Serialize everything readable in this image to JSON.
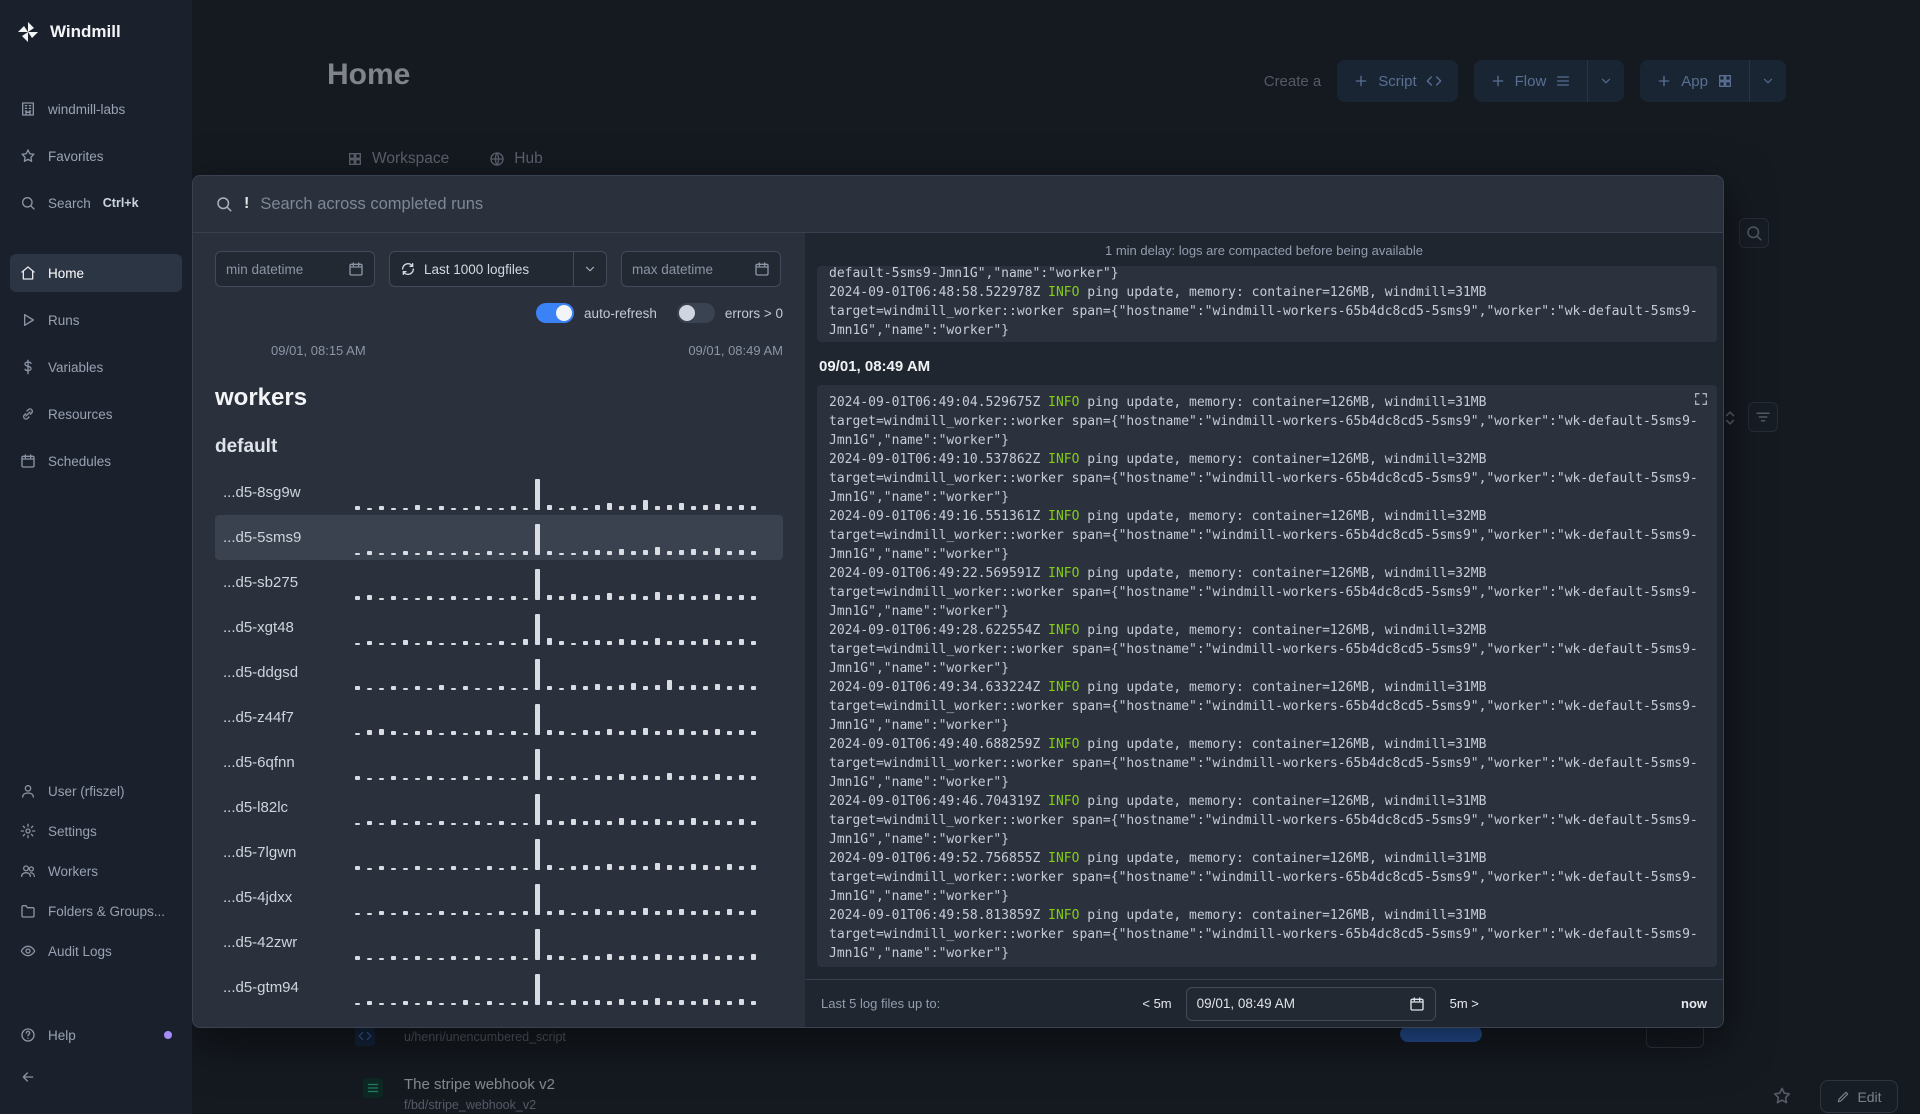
{
  "colors": {
    "accent": "#3b82f6",
    "info_level": "#84cc16",
    "spark_bar": "#d9dde3",
    "badge": "#3b82f6"
  },
  "sidebar": {
    "brand": "Windmill",
    "items": [
      {
        "id": "workspace",
        "label": "windmill-labs",
        "icon": "building"
      },
      {
        "id": "favorites",
        "label": "Favorites",
        "icon": "star"
      },
      {
        "id": "search",
        "label": "Search",
        "shortcut": "Ctrl+k",
        "icon": "search"
      },
      {
        "id": "home",
        "label": "Home",
        "icon": "home",
        "active": true,
        "gap_before": true
      },
      {
        "id": "runs",
        "label": "Runs",
        "icon": "play"
      },
      {
        "id": "variables",
        "label": "Variables",
        "icon": "dollar"
      },
      {
        "id": "resources",
        "label": "Resources",
        "icon": "link"
      },
      {
        "id": "schedules",
        "label": "Schedules",
        "icon": "calendar"
      }
    ],
    "bottom_items": [
      {
        "id": "user",
        "label": "User (rfiszel)",
        "icon": "user"
      },
      {
        "id": "settings",
        "label": "Settings",
        "icon": "gear"
      },
      {
        "id": "workers",
        "label": "Workers",
        "icon": "workers"
      },
      {
        "id": "folders",
        "label": "Folders & Groups...",
        "icon": "folder"
      },
      {
        "id": "audit-logs",
        "label": "Audit Logs",
        "icon": "eye"
      },
      {
        "id": "help",
        "label": "Help",
        "icon": "help",
        "dot": true
      }
    ]
  },
  "header": {
    "title": "Home",
    "create_label": "Create a",
    "buttons": [
      {
        "id": "script",
        "label": "Script",
        "trail_icon": "code",
        "has_dropdown": false
      },
      {
        "id": "flow",
        "label": "Flow",
        "trail_icon": "menu",
        "has_dropdown": true
      },
      {
        "id": "app",
        "label": "App",
        "trail_icon": "grid",
        "has_dropdown": true
      }
    ]
  },
  "tabs": [
    {
      "label": "Workspace",
      "icon": "grid"
    },
    {
      "label": "Hub",
      "icon": "globe"
    }
  ],
  "modal": {
    "search_prefix": "!",
    "search_placeholder": "Search across completed runs",
    "filters": {
      "min_datetime_placeholder": "min datetime",
      "logfiles_select_value": "Last 1000 logfiles",
      "max_datetime_placeholder": "max datetime",
      "auto_refresh_label": "auto-refresh",
      "errors_label": "errors > 0"
    },
    "range_start": "09/01, 08:15 AM",
    "range_end": "09/01, 08:49 AM",
    "workers_heading": "workers",
    "group_heading": "default",
    "workers": [
      {
        "name": "...d5-8sg9w",
        "spark": [
          3,
          2,
          3,
          2,
          2,
          4,
          2,
          3,
          2,
          2,
          3,
          2,
          2,
          3,
          2,
          26,
          4,
          2,
          3,
          2,
          4,
          6,
          3,
          4,
          8,
          3,
          4,
          6,
          3,
          4,
          5,
          3,
          4,
          3
        ]
      },
      {
        "name": "...d5-5sms9",
        "selected": true,
        "spark": [
          2,
          3,
          2,
          2,
          3,
          2,
          3,
          2,
          2,
          3,
          2,
          3,
          2,
          2,
          3,
          26,
          3,
          2,
          2,
          3,
          4,
          3,
          5,
          3,
          4,
          7,
          3,
          4,
          5,
          3,
          6,
          3,
          4,
          3
        ]
      },
      {
        "name": "...d5-sb275",
        "spark": [
          3,
          4,
          2,
          3,
          2,
          2,
          3,
          2,
          3,
          2,
          2,
          3,
          2,
          3,
          2,
          26,
          4,
          3,
          5,
          3,
          4,
          6,
          3,
          5,
          3,
          7,
          4,
          5,
          3,
          4,
          5,
          3,
          4,
          3
        ]
      },
      {
        "name": "...d5-xgt48",
        "spark": [
          2,
          3,
          2,
          2,
          4,
          2,
          3,
          2,
          2,
          3,
          2,
          2,
          3,
          2,
          5,
          26,
          6,
          3,
          2,
          3,
          4,
          3,
          5,
          4,
          3,
          6,
          3,
          4,
          3,
          5,
          4,
          3,
          5,
          3
        ]
      },
      {
        "name": "...d5-ddgsd",
        "spark": [
          3,
          2,
          2,
          3,
          2,
          3,
          2,
          4,
          2,
          3,
          2,
          2,
          3,
          2,
          2,
          26,
          3,
          2,
          4,
          3,
          5,
          3,
          4,
          6,
          3,
          4,
          8,
          3,
          4,
          3,
          5,
          3,
          4,
          3
        ]
      },
      {
        "name": "...d5-z44f7",
        "spark": [
          2,
          4,
          5,
          3,
          2,
          3,
          4,
          2,
          3,
          2,
          3,
          4,
          2,
          3,
          2,
          26,
          4,
          3,
          2,
          4,
          3,
          5,
          3,
          4,
          6,
          3,
          4,
          5,
          3,
          4,
          5,
          3,
          4,
          3
        ]
      },
      {
        "name": "...d5-6qfnn",
        "spark": [
          3,
          2,
          2,
          3,
          2,
          2,
          3,
          2,
          2,
          3,
          2,
          3,
          2,
          2,
          3,
          26,
          3,
          2,
          3,
          2,
          4,
          3,
          5,
          3,
          4,
          3,
          6,
          3,
          4,
          3,
          5,
          3,
          4,
          3
        ]
      },
      {
        "name": "...d5-l82lc",
        "spark": [
          2,
          3,
          2,
          4,
          2,
          3,
          2,
          3,
          2,
          2,
          3,
          2,
          3,
          2,
          2,
          26,
          4,
          3,
          5,
          3,
          4,
          3,
          6,
          4,
          3,
          5,
          3,
          4,
          6,
          3,
          4,
          3,
          5,
          3
        ]
      },
      {
        "name": "...d5-7lgwn",
        "spark": [
          3,
          2,
          3,
          2,
          2,
          3,
          2,
          2,
          3,
          2,
          2,
          3,
          2,
          3,
          2,
          26,
          4,
          2,
          3,
          4,
          3,
          5,
          3,
          4,
          3,
          6,
          4,
          3,
          5,
          4,
          3,
          5,
          3,
          4
        ]
      },
      {
        "name": "...d5-4jdxx",
        "spark": [
          2,
          2,
          3,
          2,
          3,
          2,
          2,
          3,
          2,
          3,
          2,
          2,
          3,
          2,
          3,
          26,
          3,
          4,
          2,
          3,
          5,
          3,
          4,
          3,
          6,
          3,
          4,
          5,
          3,
          4,
          3,
          5,
          3,
          4
        ]
      },
      {
        "name": "...d5-42zwr",
        "spark": [
          3,
          2,
          2,
          3,
          2,
          3,
          2,
          2,
          3,
          2,
          3,
          2,
          2,
          3,
          2,
          26,
          4,
          3,
          2,
          4,
          3,
          5,
          3,
          4,
          3,
          5,
          4,
          3,
          4,
          5,
          3,
          4,
          3,
          5
        ]
      },
      {
        "name": "...d5-gtm94",
        "spark": [
          2,
          3,
          2,
          2,
          3,
          2,
          3,
          2,
          2,
          4,
          2,
          3,
          2,
          2,
          3,
          26,
          3,
          2,
          4,
          3,
          4,
          3,
          5,
          3,
          4,
          6,
          3,
          4,
          3,
          5,
          4,
          3,
          5,
          3
        ]
      }
    ]
  },
  "logs": {
    "delay_notice": "1 min delay: logs are compacted before being available",
    "target_common": "target=windmill_worker::worker span={\"hostname\":\"windmill-workers-65b4dc8cd5-5sms9\",\"worker\":\"wk-default-5sms9-Jmn1G\",\"name\":\"worker\"}",
    "previous_block": {
      "tail_line": "default-5sms9-Jmn1G\",\"name\":\"worker\"}",
      "entries": [
        {
          "ts": "2024-09-01T06:48:58.522978Z",
          "level": "INFO",
          "msg": "ping update, memory: container=126MB, windmill=31MB"
        }
      ]
    },
    "section_header": "09/01, 08:49 AM",
    "entries": [
      {
        "ts": "2024-09-01T06:49:04.529675Z",
        "level": "INFO",
        "msg": "ping update, memory: container=126MB, windmill=31MB"
      },
      {
        "ts": "2024-09-01T06:49:10.537862Z",
        "level": "INFO",
        "msg": "ping update, memory: container=126MB, windmill=32MB"
      },
      {
        "ts": "2024-09-01T06:49:16.551361Z",
        "level": "INFO",
        "msg": "ping update, memory: container=126MB, windmill=32MB"
      },
      {
        "ts": "2024-09-01T06:49:22.569591Z",
        "level": "INFO",
        "msg": "ping update, memory: container=126MB, windmill=32MB"
      },
      {
        "ts": "2024-09-01T06:49:28.622554Z",
        "level": "INFO",
        "msg": "ping update, memory: container=126MB, windmill=32MB"
      },
      {
        "ts": "2024-09-01T06:49:34.633224Z",
        "level": "INFO",
        "msg": "ping update, memory: container=126MB, windmill=31MB"
      },
      {
        "ts": "2024-09-01T06:49:40.688259Z",
        "level": "INFO",
        "msg": "ping update, memory: container=126MB, windmill=31MB"
      },
      {
        "ts": "2024-09-01T06:49:46.704319Z",
        "level": "INFO",
        "msg": "ping update, memory: container=126MB, windmill=31MB"
      },
      {
        "ts": "2024-09-01T06:49:52.756855Z",
        "level": "INFO",
        "msg": "ping update, memory: container=126MB, windmill=31MB"
      },
      {
        "ts": "2024-09-01T06:49:58.813859Z",
        "level": "INFO",
        "msg": "ping update, memory: container=126MB, windmill=31MB"
      }
    ],
    "footer": {
      "label": "Last 5 log files up to:",
      "back_label": "< 5m",
      "datetime_value": "09/01, 08:49 AM",
      "forward_label": "5m >",
      "now_label": "now"
    }
  },
  "background": {
    "rows": [
      {
        "path": "u/henri/unencumbered_script"
      },
      {
        "title": "The stripe webhook v2",
        "path": "f/bd/stripe_webhook_v2",
        "edit_label": "Edit"
      }
    ]
  }
}
